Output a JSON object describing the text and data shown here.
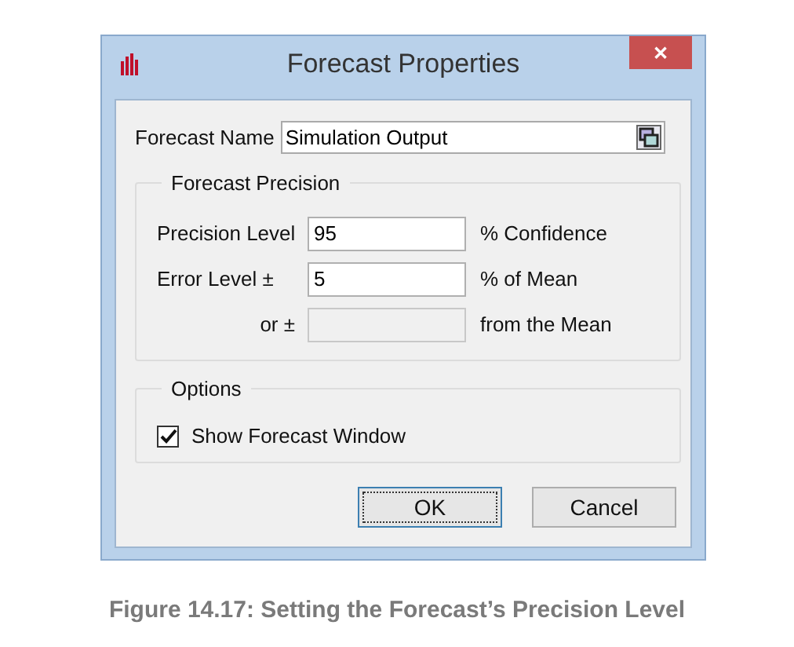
{
  "window": {
    "title": "Forecast Properties",
    "close": "✕"
  },
  "forecast_name": {
    "label": "Forecast Name",
    "value": "Simulation Output"
  },
  "precision_group": {
    "title": "Forecast Precision",
    "rows": [
      {
        "label": "Precision Level",
        "value": "95",
        "unit": "% Confidence",
        "disabled": false
      },
      {
        "label": "Error Level ±",
        "value": "5",
        "unit": "% of Mean",
        "disabled": false
      },
      {
        "label": "or ±",
        "value": "",
        "unit": "from the Mean",
        "disabled": true
      }
    ]
  },
  "options_group": {
    "title": "Options",
    "checkbox": {
      "label": "Show Forecast Window",
      "checked": true
    }
  },
  "buttons": [
    {
      "label": "OK",
      "focused": true
    },
    {
      "label": "Cancel",
      "focused": false
    }
  ],
  "caption": "Figure 14.17: Setting the Forecast’s Precision Level"
}
